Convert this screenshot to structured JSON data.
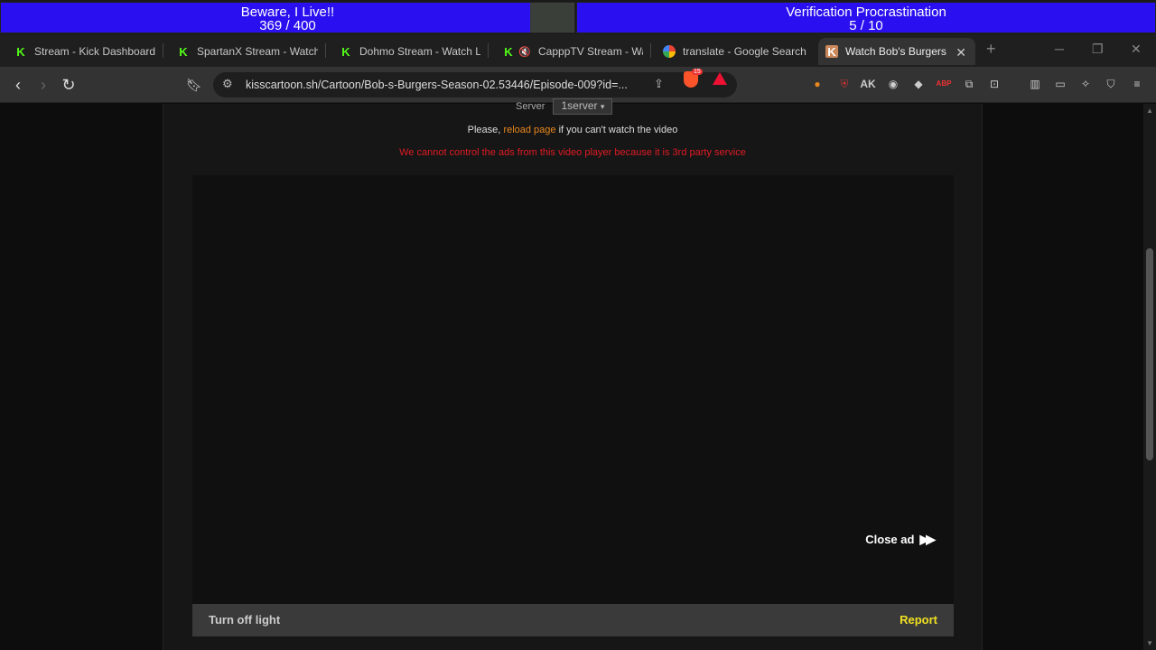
{
  "overlay": {
    "goal1": {
      "title": "Beware, I Live!!",
      "count": "369 / 400",
      "progress": 0.9225
    },
    "goal2": {
      "title": "Verification Procrastination",
      "count": "5 / 10",
      "progress": 1.0
    }
  },
  "tabs": [
    {
      "label": "Stream - Kick Dashboard",
      "icon": "kick-icon"
    },
    {
      "label": "SpartanX Stream - Watch L",
      "icon": "kick-icon"
    },
    {
      "label": "Dohmo Stream - Watch Liv",
      "icon": "kick-icon"
    },
    {
      "label": "CapppTV Stream - Wat",
      "icon": "kick-icon"
    },
    {
      "label": "translate - Google Search",
      "icon": "google-icon"
    },
    {
      "label": "Watch Bob's Burgers S",
      "icon": "kisscartoon-icon"
    }
  ],
  "toolbar": {
    "url": "kisscartoon.sh/Cartoon/Bob-s-Burgers-Season-02.53446/Episode-009?id=...",
    "brave_badge": "15"
  },
  "page": {
    "server_label": "Server",
    "server_value": "1server",
    "reload_prefix": "Please,",
    "reload_link": "reload page",
    "reload_suffix": "if you can't watch the video",
    "warning": "We cannot control the ads from this video player because it is 3rd party service",
    "close_ad": "Close ad",
    "turn_off_light": "Turn off light",
    "report": "Report"
  },
  "colors": {
    "goal_fill": "#2a0ff0",
    "reload_link": "#e8871e",
    "warning": "#e01b24",
    "report": "#f0e022"
  }
}
